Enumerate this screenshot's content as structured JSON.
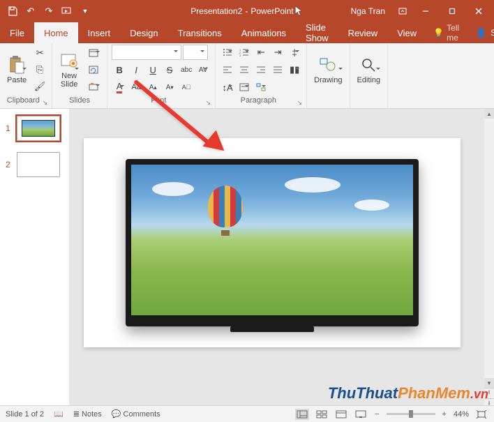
{
  "titlebar": {
    "doc": "Presentation2",
    "app": "PowerPoint",
    "user": "Nga Tran"
  },
  "tabs": {
    "file": "File",
    "home": "Home",
    "insert": "Insert",
    "design": "Design",
    "transitions": "Transitions",
    "animations": "Animations",
    "slideshow": "Slide Show",
    "review": "Review",
    "view": "View",
    "tellme": "Tell me",
    "share": "Share"
  },
  "ribbon": {
    "clipboard": {
      "label": "Clipboard",
      "paste": "Paste"
    },
    "slides": {
      "label": "Slides",
      "newslide": "New\nSlide"
    },
    "font": {
      "label": "Font"
    },
    "paragraph": {
      "label": "Paragraph"
    },
    "drawing": {
      "label": "Drawing"
    },
    "editing": {
      "label": "Editing"
    }
  },
  "thumbs": {
    "n1": "1",
    "n2": "2"
  },
  "status": {
    "slide": "Slide 1 of 2",
    "notes": "Notes",
    "comments": "Comments",
    "zoom": "44%"
  },
  "watermark": {
    "thu": "ThuThuat",
    "phanmem": "PhanMem",
    "vn": ".vn"
  }
}
